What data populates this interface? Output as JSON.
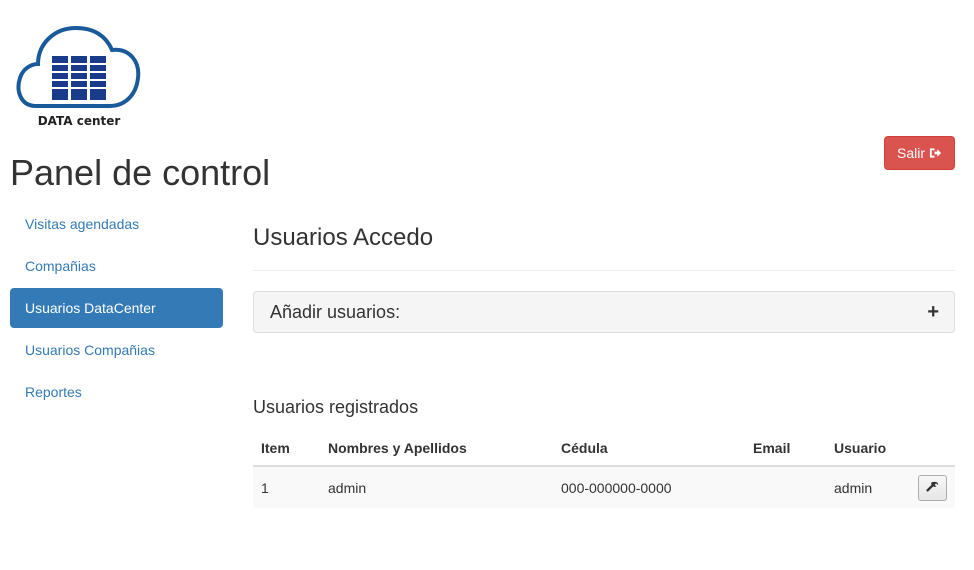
{
  "brand": {
    "logo_text": "DATA center",
    "colors": {
      "logo_blue": "#1a5a9a",
      "primary": "#337ab7",
      "danger": "#d9534f"
    }
  },
  "header": {
    "title": "Panel de control",
    "logout_label": "Salir",
    "logout_icon": "sign-out-icon"
  },
  "sidebar": {
    "items": [
      {
        "label": "Visitas agendadas",
        "active": false
      },
      {
        "label": "Compañias",
        "active": false
      },
      {
        "label": "Usuarios DataCenter",
        "active": true
      },
      {
        "label": "Usuarios Compañias",
        "active": false
      },
      {
        "label": "Reportes",
        "active": false
      }
    ]
  },
  "main": {
    "title": "Usuarios Accedo",
    "add_panel": {
      "title": "Añadir usuarios:",
      "toggle_symbol": "+"
    },
    "registered": {
      "title": "Usuarios registrados",
      "columns": [
        "Item",
        "Nombres y Apellidos",
        "Cédula",
        "Email",
        "Usuario"
      ],
      "rows": [
        {
          "item": "1",
          "name": "admin",
          "cedula": "000-000000-0000",
          "email": "",
          "usuario": "admin",
          "action_icon": "wrench-icon"
        }
      ]
    }
  }
}
